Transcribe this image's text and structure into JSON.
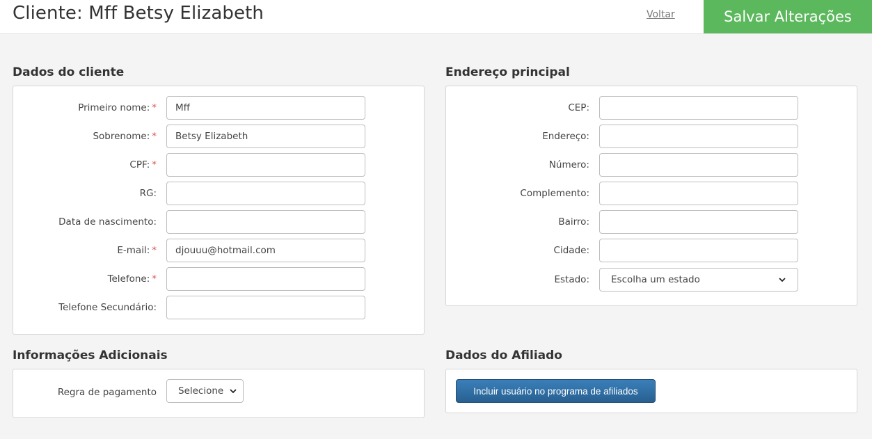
{
  "header": {
    "title": "Cliente: Mff Betsy Elizabeth",
    "back_label": "Voltar",
    "save_label": "Salvar Alterações"
  },
  "client": {
    "section_title": "Dados do cliente",
    "required_mark": "*",
    "fields": [
      {
        "label": "Primeiro nome:",
        "value": "Mff",
        "required": true
      },
      {
        "label": "Sobrenome:",
        "value": "Betsy Elizabeth",
        "required": true
      },
      {
        "label": "CPF:",
        "value": "",
        "required": true
      },
      {
        "label": "RG:",
        "value": "",
        "required": false
      },
      {
        "label": "Data de nascimento:",
        "value": "",
        "required": false
      },
      {
        "label": "E-mail:",
        "value": "djouuu@hotmail.com",
        "required": true
      },
      {
        "label": "Telefone:",
        "value": "",
        "required": true
      },
      {
        "label": "Telefone Secundário:",
        "value": "",
        "required": false
      }
    ]
  },
  "address": {
    "section_title": "Endereço principal",
    "fields": [
      {
        "label": "CEP:",
        "value": ""
      },
      {
        "label": "Endereço:",
        "value": ""
      },
      {
        "label": "Número:",
        "value": ""
      },
      {
        "label": "Complemento:",
        "value": ""
      },
      {
        "label": "Bairro:",
        "value": ""
      },
      {
        "label": "Cidade:",
        "value": ""
      }
    ],
    "state_label": "Estado:",
    "state_value": "Escolha um estado"
  },
  "additional": {
    "section_title": "Informações Adicionais",
    "payment_label": "Regra de pagamento",
    "payment_value": "Selecione"
  },
  "affiliate": {
    "section_title": "Dados do Afiliado",
    "button_label": "Incluir usuário no programa de afiliados"
  },
  "colors": {
    "save_button": "#5cb85c",
    "affiliate_button": "#286090",
    "required": "#d9534f"
  }
}
